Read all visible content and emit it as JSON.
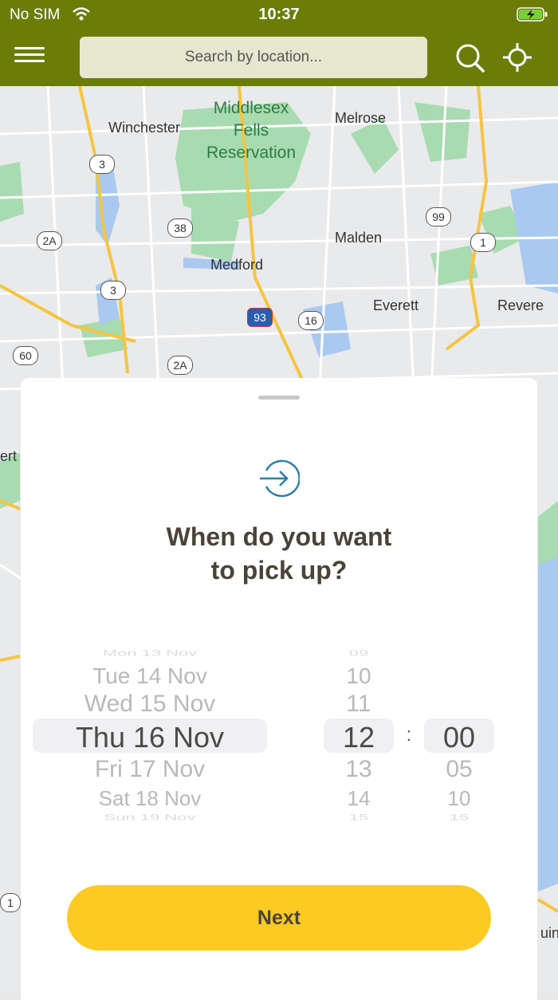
{
  "status": {
    "carrier": "No SIM",
    "time": "10:37"
  },
  "header": {
    "search_placeholder": "Search by location..."
  },
  "map": {
    "labels": [
      "Winchester",
      "Melrose",
      "Malden",
      "Medford",
      "Everett",
      "Revere",
      "ert",
      "uin"
    ],
    "park_label": [
      "Middlesex",
      "Fells",
      "Reservation"
    ],
    "shields": [
      "3",
      "2A",
      "38",
      "99",
      "1",
      "3",
      "16",
      "93",
      "60",
      "2A",
      "1"
    ]
  },
  "sheet": {
    "title_line1": "When do you want",
    "title_line2": "to pick up?",
    "dates": [
      "Mon 13 Nov",
      "Tue 14 Nov",
      "Wed 15 Nov",
      "Thu 16 Nov",
      "Fri 17 Nov",
      "Sat 18 Nov",
      "Sun 19 Nov"
    ],
    "hours": [
      "09",
      "10",
      "11",
      "12",
      "13",
      "14",
      "15"
    ],
    "minutes": [
      "00",
      "05",
      "10",
      "15"
    ],
    "separator": ":",
    "next_label": "Next"
  },
  "colors": {
    "header": "#6b7d06",
    "button": "#fcca22",
    "title": "#4b4338"
  }
}
